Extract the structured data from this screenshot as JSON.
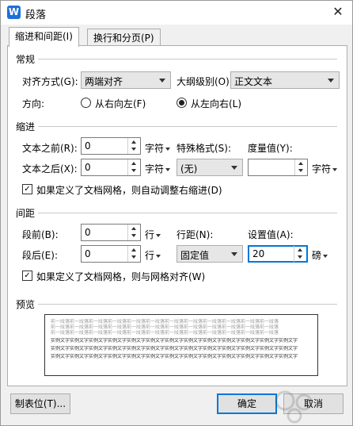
{
  "window": {
    "title": "段落",
    "app_icon_letter": "W"
  },
  "tabs": [
    {
      "label": "缩进和间距(I)"
    },
    {
      "label": "换行和分页(P)"
    }
  ],
  "general": {
    "heading": "常规",
    "alignment_label": "对齐方式(G):",
    "alignment_value": "两端对齐",
    "outline_label": "大纲级别(O):",
    "outline_value": "正文文本",
    "direction_label": "方向:",
    "rtl_label": "从右向左(F)",
    "ltr_label": "从左向右(L)",
    "direction_selected": "ltr"
  },
  "indent": {
    "heading": "缩进",
    "before_label": "文本之前(R):",
    "before_value": "0",
    "before_unit": "字符",
    "after_label": "文本之后(X):",
    "after_value": "0",
    "after_unit": "字符",
    "special_label": "特殊格式(S):",
    "special_value": "(无)",
    "measure_label": "度量值(Y):",
    "measure_value": "",
    "measure_unit": "字符",
    "auto_adjust_label": "如果定义了文档网格，则自动调整右缩进(D)",
    "auto_adjust_checked": true
  },
  "spacing": {
    "heading": "间距",
    "before_label": "段前(B):",
    "before_value": "0",
    "before_unit": "行",
    "after_label": "段后(E):",
    "after_value": "0",
    "after_unit": "行",
    "line_label": "行距(N):",
    "line_value": "固定值",
    "setting_label": "设置值(A):",
    "setting_value": "20",
    "setting_unit": "磅",
    "snap_grid_label": "如果定义了文档网格，则与网格对齐(W)",
    "snap_grid_checked": true
  },
  "preview": {
    "heading": "预览",
    "prev_line": "前一段落前一段落前一段落前一段落前一段落前一段落前一段落前一段落前一段落前一段落前一段落前一段落",
    "sample_line": "实例文字实例文字实例文字实例文字实例文字实例文字实例文字实例文字实例文字实例文字实例文字实例文字实例文字"
  },
  "footer": {
    "tabs_button": "制表位(T)...",
    "ok_button": "确定",
    "cancel_button": "取消"
  },
  "colors": {
    "accent": "#0078d7",
    "app_icon": "#1e6fd9"
  }
}
